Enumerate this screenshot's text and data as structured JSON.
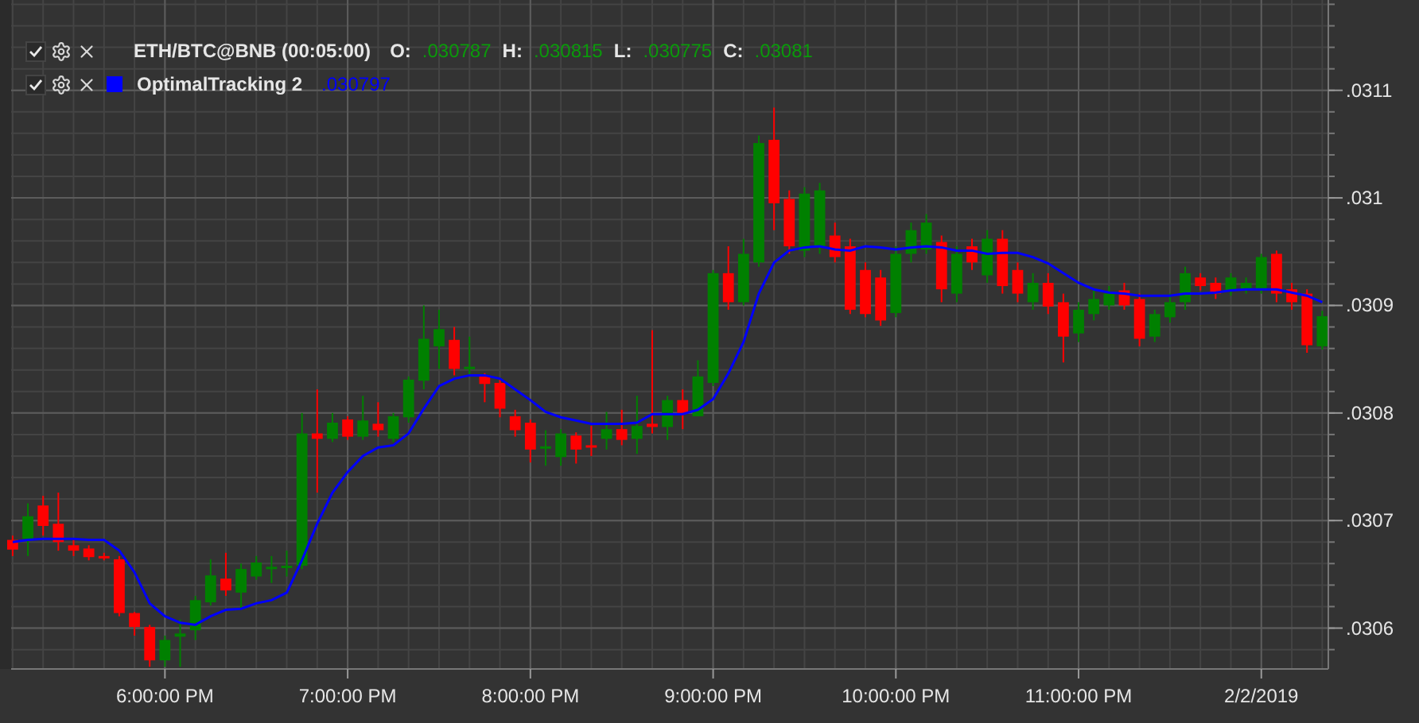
{
  "legend": [
    {
      "kind": "candles",
      "checked": true,
      "title": "ETH/BTC@BNB (00:05:00)",
      "fields": [
        {
          "label": "O:",
          "value": ".030787"
        },
        {
          "label": "H:",
          "value": ".030815"
        },
        {
          "label": "L:",
          "value": ".030775"
        },
        {
          "label": "C:",
          "value": ".03081"
        }
      ]
    },
    {
      "kind": "line",
      "checked": true,
      "value": ".030797"
    }
  ],
  "chart_data": {
    "type": "candlestick",
    "categories": [
      null,
      null,
      null,
      null,
      null,
      null,
      null,
      null,
      null,
      null,
      "6:00:00 PM",
      null,
      null,
      null,
      null,
      null,
      null,
      null,
      null,
      null,
      null,
      null,
      "7:00:00 PM",
      null,
      null,
      null,
      null,
      null,
      null,
      null,
      null,
      null,
      null,
      null,
      "8:00:00 PM",
      null,
      null,
      null,
      null,
      null,
      null,
      null,
      null,
      null,
      null,
      null,
      "9:00:00 PM",
      null,
      null,
      null,
      null,
      null,
      null,
      null,
      null,
      null,
      null,
      null,
      "10:00:00 PM",
      null,
      null,
      null,
      null,
      null,
      null,
      null,
      null,
      null,
      null,
      null,
      "11:00:00 PM",
      null,
      null,
      null,
      null,
      null,
      null,
      null,
      null,
      null,
      null,
      null,
      "2/2/2019",
      null,
      null,
      null,
      null
    ],
    "ylim": [
      0.030562,
      0.031184
    ],
    "grid": true,
    "yticks": [
      {
        "value": 0.0306,
        "label": ".0306"
      },
      {
        "value": 0.0307,
        "label": ".0307"
      },
      {
        "value": 0.0308,
        "label": ".0308"
      },
      {
        "value": 0.0309,
        "label": ".0309"
      },
      {
        "value": 0.031,
        "label": ".031"
      },
      {
        "value": 0.0311,
        "label": ".0311"
      }
    ],
    "ohlc": [
      [
        0.030682,
        0.030686,
        0.030667,
        0.030673
      ],
      [
        0.030683,
        0.030716,
        0.030667,
        0.030704
      ],
      [
        0.030714,
        0.030723,
        0.030686,
        0.030695
      ],
      [
        0.030697,
        0.030726,
        0.030672,
        0.03068
      ],
      [
        0.030677,
        0.030682,
        0.030667,
        0.030672
      ],
      [
        0.030674,
        0.030677,
        0.030663,
        0.030666
      ],
      [
        0.030667,
        0.03067,
        0.030663,
        0.030666
      ],
      [
        0.030664,
        0.030667,
        0.030611,
        0.030614
      ],
      [
        0.030614,
        0.030615,
        0.030593,
        0.030601
      ],
      [
        0.030601,
        0.030603,
        0.030564,
        0.03057
      ],
      [
        0.03057,
        0.030593,
        0.030564,
        0.030589
      ],
      [
        0.030592,
        0.030608,
        0.030564,
        0.030595
      ],
      [
        0.030598,
        0.03063,
        0.030589,
        0.030626
      ],
      [
        0.030624,
        0.030664,
        0.030621,
        0.030649
      ],
      [
        0.030646,
        0.03067,
        0.03063,
        0.030635
      ],
      [
        0.030633,
        0.03066,
        0.030618,
        0.030655
      ],
      [
        0.030648,
        0.030667,
        0.030645,
        0.030661
      ],
      [
        0.030655,
        0.030667,
        0.030642,
        0.030657
      ],
      [
        0.030657,
        0.030672,
        0.030648,
        0.030658
      ],
      [
        0.030658,
        0.0308,
        0.030655,
        0.030781
      ],
      [
        0.030781,
        0.030822,
        0.030726,
        0.030776
      ],
      [
        0.030776,
        0.0308,
        0.030773,
        0.030791
      ],
      [
        0.030794,
        0.030797,
        0.030775,
        0.030778
      ],
      [
        0.030778,
        0.030816,
        0.030775,
        0.030793
      ],
      [
        0.03079,
        0.03081,
        0.030778,
        0.030784
      ],
      [
        0.030776,
        0.0308,
        0.030773,
        0.030797
      ],
      [
        0.030796,
        0.030834,
        0.030791,
        0.030831
      ],
      [
        0.03083,
        0.0309,
        0.030822,
        0.030869
      ],
      [
        0.030862,
        0.030896,
        0.030841,
        0.030878
      ],
      [
        0.030868,
        0.03088,
        0.030835,
        0.030841
      ],
      [
        0.030841,
        0.030871,
        0.030834,
        0.030843
      ],
      [
        0.030834,
        0.030837,
        0.03081,
        0.030827
      ],
      [
        0.030828,
        0.030831,
        0.030796,
        0.030804
      ],
      [
        0.030797,
        0.030803,
        0.030778,
        0.030784
      ],
      [
        0.030791,
        0.030794,
        0.030754,
        0.030766
      ],
      [
        0.030768,
        0.030784,
        0.030751,
        0.030769
      ],
      [
        0.030759,
        0.030785,
        0.030751,
        0.030781
      ],
      [
        0.030779,
        0.030782,
        0.030753,
        0.030766
      ],
      [
        0.03077,
        0.030788,
        0.03076,
        0.030768
      ],
      [
        0.030776,
        0.030801,
        0.030766,
        0.030785
      ],
      [
        0.030785,
        0.030803,
        0.03077,
        0.030775
      ],
      [
        0.030776,
        0.030816,
        0.030762,
        0.030788
      ],
      [
        0.03079,
        0.030877,
        0.030781,
        0.030787
      ],
      [
        0.030787,
        0.030816,
        0.030775,
        0.030812
      ],
      [
        0.030812,
        0.030822,
        0.030785,
        0.0308
      ],
      [
        0.030797,
        0.030849,
        0.030797,
        0.030834
      ],
      [
        0.030828,
        0.030933,
        0.030825,
        0.03093
      ],
      [
        0.03093,
        0.030955,
        0.030896,
        0.030903
      ],
      [
        0.030903,
        0.030962,
        0.0309,
        0.030948
      ],
      [
        0.03094,
        0.031058,
        0.030936,
        0.031051
      ],
      [
        0.031054,
        0.031084,
        0.03097,
        0.030995
      ],
      [
        0.030999,
        0.031007,
        0.030948,
        0.030955
      ],
      [
        0.030951,
        0.03101,
        0.030945,
        0.031004
      ],
      [
        0.030955,
        0.031014,
        0.030948,
        0.031007
      ],
      [
        0.030965,
        0.030977,
        0.03094,
        0.030945
      ],
      [
        0.030955,
        0.030962,
        0.030892,
        0.030896
      ],
      [
        0.030933,
        0.03094,
        0.030889,
        0.030892
      ],
      [
        0.030926,
        0.030933,
        0.030881,
        0.030886
      ],
      [
        0.030893,
        0.030955,
        0.030889,
        0.030948
      ],
      [
        0.030948,
        0.030977,
        0.03094,
        0.03097
      ],
      [
        0.030952,
        0.030985,
        0.030948,
        0.030977
      ],
      [
        0.030959,
        0.030965,
        0.030903,
        0.030915
      ],
      [
        0.030911,
        0.030955,
        0.030903,
        0.030948
      ],
      [
        0.030955,
        0.030962,
        0.030933,
        0.03094
      ],
      [
        0.030928,
        0.03097,
        0.030921,
        0.030962
      ],
      [
        0.030962,
        0.03097,
        0.030911,
        0.030918
      ],
      [
        0.030933,
        0.03094,
        0.030903,
        0.030911
      ],
      [
        0.030903,
        0.03093,
        0.030896,
        0.030921
      ],
      [
        0.030921,
        0.03093,
        0.030892,
        0.030899
      ],
      [
        0.030903,
        0.030911,
        0.030847,
        0.030871
      ],
      [
        0.030874,
        0.030903,
        0.030866,
        0.030896
      ],
      [
        0.030892,
        0.030914,
        0.030886,
        0.030906
      ],
      [
        0.0309,
        0.030918,
        0.030896,
        0.030911
      ],
      [
        0.030914,
        0.030921,
        0.030896,
        0.0309
      ],
      [
        0.030906,
        0.030911,
        0.030862,
        0.030869
      ],
      [
        0.030871,
        0.030896,
        0.030866,
        0.030892
      ],
      [
        0.030889,
        0.030911,
        0.030884,
        0.030903
      ],
      [
        0.030903,
        0.030936,
        0.030896,
        0.03093
      ],
      [
        0.030926,
        0.03093,
        0.030914,
        0.030918
      ],
      [
        0.030921,
        0.030926,
        0.030906,
        0.030911
      ],
      [
        0.030914,
        0.03093,
        0.030909,
        0.030926
      ],
      [
        0.030915,
        0.030926,
        0.030911,
        0.030921
      ],
      [
        0.030915,
        0.030948,
        0.030911,
        0.030945
      ],
      [
        0.030948,
        0.030951,
        0.030903,
        0.030911
      ],
      [
        0.030915,
        0.030921,
        0.030896,
        0.030903
      ],
      [
        0.030911,
        0.030915,
        0.030856,
        0.030863
      ],
      [
        0.030862,
        0.030895,
        0.030859,
        0.03089
      ]
    ],
    "series": [
      {
        "name": "OptimalTracking 2",
        "type": "line",
        "color": "#0000ff",
        "values": [
          0.03068,
          0.030682,
          0.030683,
          0.030683,
          0.030683,
          0.030682,
          0.030682,
          0.030672,
          0.030652,
          0.030623,
          0.030611,
          0.030605,
          0.030603,
          0.030611,
          0.030617,
          0.030618,
          0.030623,
          0.030626,
          0.030633,
          0.030663,
          0.030697,
          0.030726,
          0.030745,
          0.03076,
          0.030768,
          0.03077,
          0.030781,
          0.030804,
          0.030825,
          0.030832,
          0.030835,
          0.030835,
          0.030832,
          0.030822,
          0.030812,
          0.030801,
          0.030796,
          0.030793,
          0.03079,
          0.03079,
          0.03079,
          0.030791,
          0.030799,
          0.030799,
          0.030799,
          0.030803,
          0.030813,
          0.030837,
          0.030866,
          0.030911,
          0.03094,
          0.030951,
          0.030954,
          0.030955,
          0.030952,
          0.030951,
          0.030955,
          0.030954,
          0.030952,
          0.030954,
          0.030955,
          0.030954,
          0.030951,
          0.030951,
          0.030948,
          0.030949,
          0.030949,
          0.030945,
          0.030939,
          0.03093,
          0.030921,
          0.030915,
          0.030912,
          0.030911,
          0.030909,
          0.030909,
          0.030909,
          0.030911,
          0.030911,
          0.030912,
          0.030914,
          0.030915,
          0.030915,
          0.030915,
          0.030912,
          0.030909,
          0.030903
        ]
      }
    ]
  }
}
